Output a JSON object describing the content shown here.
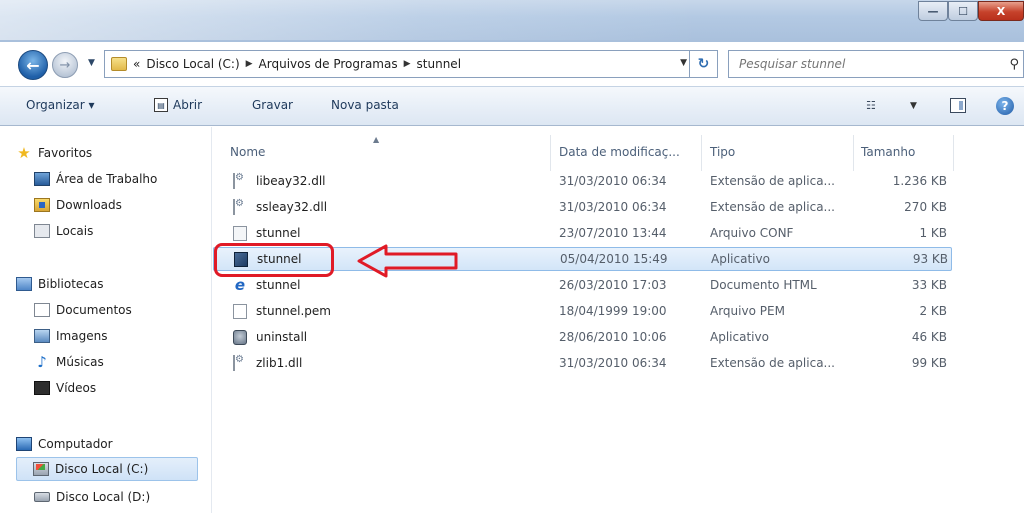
{
  "window": {
    "minimize": "—",
    "maximize": "☐",
    "close": "X"
  },
  "address": {
    "breadcrumb": [
      "«",
      "Disco Local (C:)",
      "Arquivos de Programas",
      "stunnel"
    ]
  },
  "search": {
    "placeholder": "Pesquisar stunnel"
  },
  "toolbar": {
    "organizar": "Organizar ▾",
    "abrir": "Abrir",
    "gravar": "Gravar",
    "nova_pasta": "Nova pasta"
  },
  "sidebar": {
    "favoritos": "Favoritos",
    "area_trabalho": "Área de Trabalho",
    "downloads": "Downloads",
    "locais": "Locais",
    "bibliotecas": "Bibliotecas",
    "documentos": "Documentos",
    "imagens": "Imagens",
    "musicas": "Músicas",
    "videos": "Vídeos",
    "computador": "Computador",
    "disco_c": "Disco Local (C:)",
    "disco_d": "Disco Local (D:)"
  },
  "columns": {
    "name": "Nome",
    "date": "Data de modificaç...",
    "type": "Tipo",
    "size": "Tamanho"
  },
  "files": [
    {
      "name": "libeay32.dll",
      "date": "31/03/2010 06:34",
      "type": "Extensão de aplica...",
      "size": "1.236 KB",
      "icon": "dll-icon"
    },
    {
      "name": "ssleay32.dll",
      "date": "31/03/2010 06:34",
      "type": "Extensão de aplica...",
      "size": "270 KB",
      "icon": "dll-icon"
    },
    {
      "name": "stunnel",
      "date": "23/07/2010 13:44",
      "type": "Arquivo CONF",
      "size": "1 KB",
      "icon": "conf-file-icon"
    },
    {
      "name": "stunnel",
      "date": "05/04/2010 15:49",
      "type": "Aplicativo",
      "size": "93 KB",
      "icon": "application-icon"
    },
    {
      "name": "stunnel",
      "date": "26/03/2010 17:03",
      "type": "Documento HTML",
      "size": "33 KB",
      "icon": "html-document-icon"
    },
    {
      "name": "stunnel.pem",
      "date": "18/04/1999 19:00",
      "type": "Arquivo PEM",
      "size": "2 KB",
      "icon": "pem-file-icon"
    },
    {
      "name": "uninstall",
      "date": "28/06/2010 10:06",
      "type": "Aplicativo",
      "size": "46 KB",
      "icon": "uninstall-icon"
    },
    {
      "name": "zlib1.dll",
      "date": "31/03/2010 06:34",
      "type": "Extensão de aplica...",
      "size": "99 KB",
      "icon": "dll-icon"
    }
  ],
  "colors": {
    "annotation": "#e01a26",
    "selection": "#d3e5f8"
  }
}
